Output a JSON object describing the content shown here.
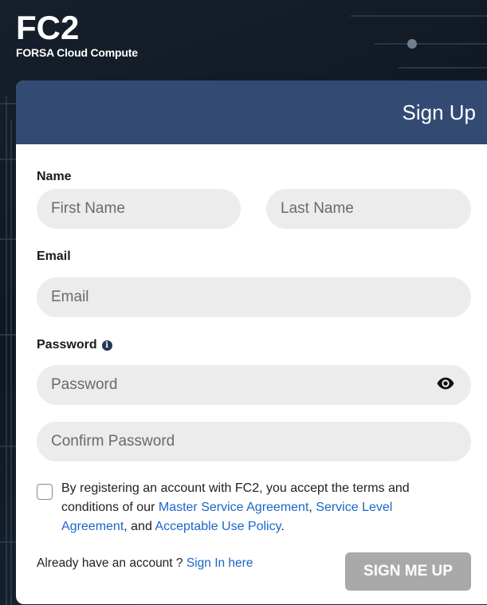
{
  "brand": {
    "logo": "FC2",
    "tagline": "FORSA Cloud Compute"
  },
  "form": {
    "title": "Sign Up",
    "name_label": "Name",
    "first_name_placeholder": "First Name",
    "last_name_placeholder": "Last Name",
    "email_label": "Email",
    "email_placeholder": "Email",
    "password_label": "Password",
    "password_placeholder": "Password",
    "confirm_password_placeholder": "Confirm Password",
    "terms": {
      "prefix": "By registering an account with FC2, you accept the terms and conditions of our ",
      "link_msa": "Master Service Agreement",
      "sep1": ", ",
      "link_sla": "Service Level Agreement",
      "sep2": ", and ",
      "link_aup": "Acceptable Use Policy",
      "suffix": "."
    },
    "already_text": "Already have an account ? ",
    "sign_in_link": "Sign In here",
    "submit_label": "SIGN ME UP"
  },
  "colors": {
    "header": "#334a73",
    "link": "#1a66c9",
    "button_disabled": "#a9a9a9",
    "field_bg": "#ececec"
  },
  "icons": {
    "password_info": "info-icon",
    "password_toggle": "eye-icon"
  }
}
